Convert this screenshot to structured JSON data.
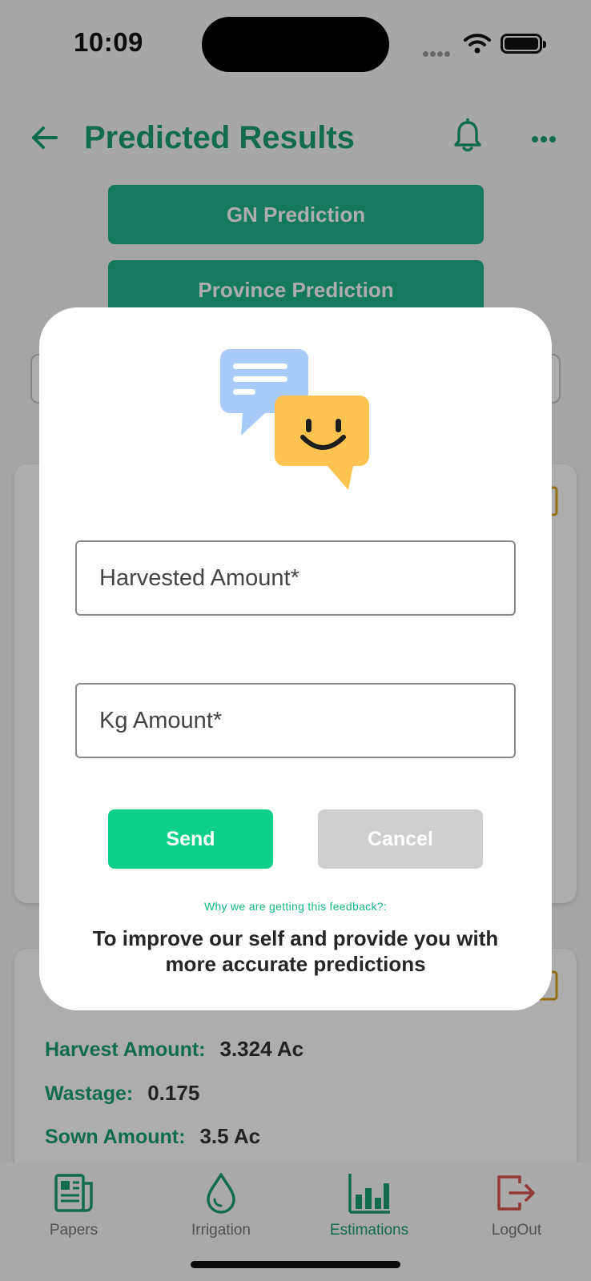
{
  "status_bar": {
    "time": "10:09"
  },
  "header": {
    "title": "Predicted Results"
  },
  "prediction_buttons": {
    "gn": "GN Prediction",
    "province": "Province Prediction"
  },
  "card": {
    "rows": [
      {
        "label": "Harvest Amount:",
        "value": "3.324 Ac"
      },
      {
        "label": "Wastage:",
        "value": "0.175"
      },
      {
        "label": "Sown Amount:",
        "value": "3.5 Ac"
      }
    ]
  },
  "dialog": {
    "harvested_placeholder": "Harvested Amount*",
    "kg_placeholder": "Kg Amount*",
    "send_label": "Send",
    "cancel_label": "Cancel",
    "why_text": "Why we are getting this feedback?:",
    "reason_text": "To improve our self and provide you with more accurate predictions"
  },
  "tabbar": {
    "tabs": [
      {
        "label": "Papers",
        "icon": "newspaper-icon"
      },
      {
        "label": "Irrigation",
        "icon": "water-drop-icon"
      },
      {
        "label": "Estimations",
        "icon": "bar-chart-icon",
        "active": true
      },
      {
        "label": "LogOut",
        "icon": "logout-icon"
      }
    ]
  },
  "colors": {
    "brand_green": "#1a9e72",
    "send_green": "#0fd08a",
    "cancel_gray": "#cfcfcf",
    "logout_red": "#d9534f"
  }
}
